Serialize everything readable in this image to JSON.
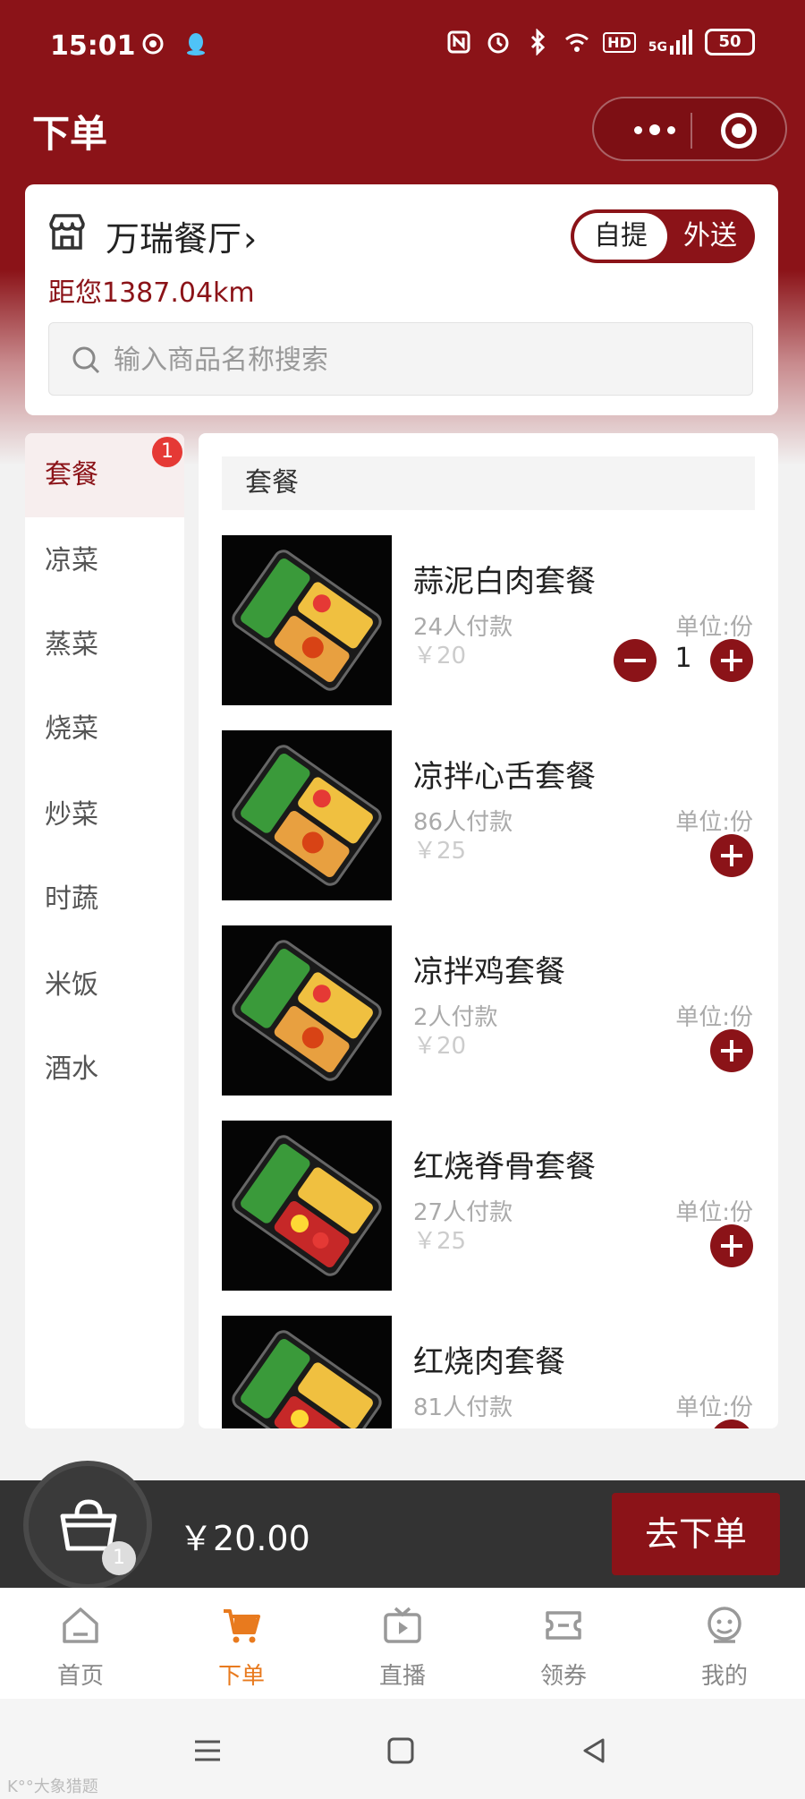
{
  "status_bar": {
    "time": "15:01",
    "left_icons": [
      "netease-icon",
      "qq-icon"
    ],
    "right_icons": [
      "nfc-icon",
      "alarm-icon",
      "bluetooth-icon",
      "wifi-icon",
      "hd-icon",
      "5g-signal-icon"
    ],
    "hd_label": "HD",
    "signal_label": "5G",
    "battery": "50"
  },
  "header": {
    "title": "下单"
  },
  "store": {
    "name": "万瑞餐厅",
    "chevron": "›",
    "distance": "距您1387.04km",
    "modes": {
      "pickup": "自提",
      "delivery": "外送",
      "selected": "delivery"
    }
  },
  "search": {
    "placeholder": "输入商品名称搜索"
  },
  "categories": {
    "items": [
      {
        "label": "套餐",
        "active": true
      },
      {
        "label": "凉菜"
      },
      {
        "label": "蒸菜"
      },
      {
        "label": "烧菜"
      },
      {
        "label": "炒菜"
      },
      {
        "label": "时蔬"
      },
      {
        "label": "米饭"
      },
      {
        "label": "酒水"
      }
    ],
    "badge": "1"
  },
  "section": {
    "title": "套餐"
  },
  "products": [
    {
      "name": "蒜泥白肉套餐",
      "sales": "24人付款",
      "price": "￥20",
      "unit": "单位:份",
      "qty": "1"
    },
    {
      "name": "凉拌心舌套餐",
      "sales": "86人付款",
      "price": "￥25",
      "unit": "单位:份"
    },
    {
      "name": "凉拌鸡套餐",
      "sales": "2人付款",
      "price": "￥20",
      "unit": "单位:份"
    },
    {
      "name": "红烧脊骨套餐",
      "sales": "27人付款",
      "price": "￥25",
      "unit": "单位:份"
    },
    {
      "name": "红烧肉套餐",
      "sales": "81人付款",
      "price": "",
      "unit": "单位:份"
    }
  ],
  "cart": {
    "count": "1",
    "total": "￥20.00",
    "checkout_label": "去下单"
  },
  "tabs": [
    {
      "label": "首页",
      "icon": "home-icon"
    },
    {
      "label": "下单",
      "icon": "cart-icon",
      "active": true
    },
    {
      "label": "直播",
      "icon": "tv-icon"
    },
    {
      "label": "领券",
      "icon": "ticket-icon"
    },
    {
      "label": "我的",
      "icon": "profile-icon"
    }
  ],
  "watermark": "K°°大象猎题",
  "colors": {
    "brand": "#8b1318",
    "tab_active": "#e87a1e",
    "badge": "#e53935"
  }
}
